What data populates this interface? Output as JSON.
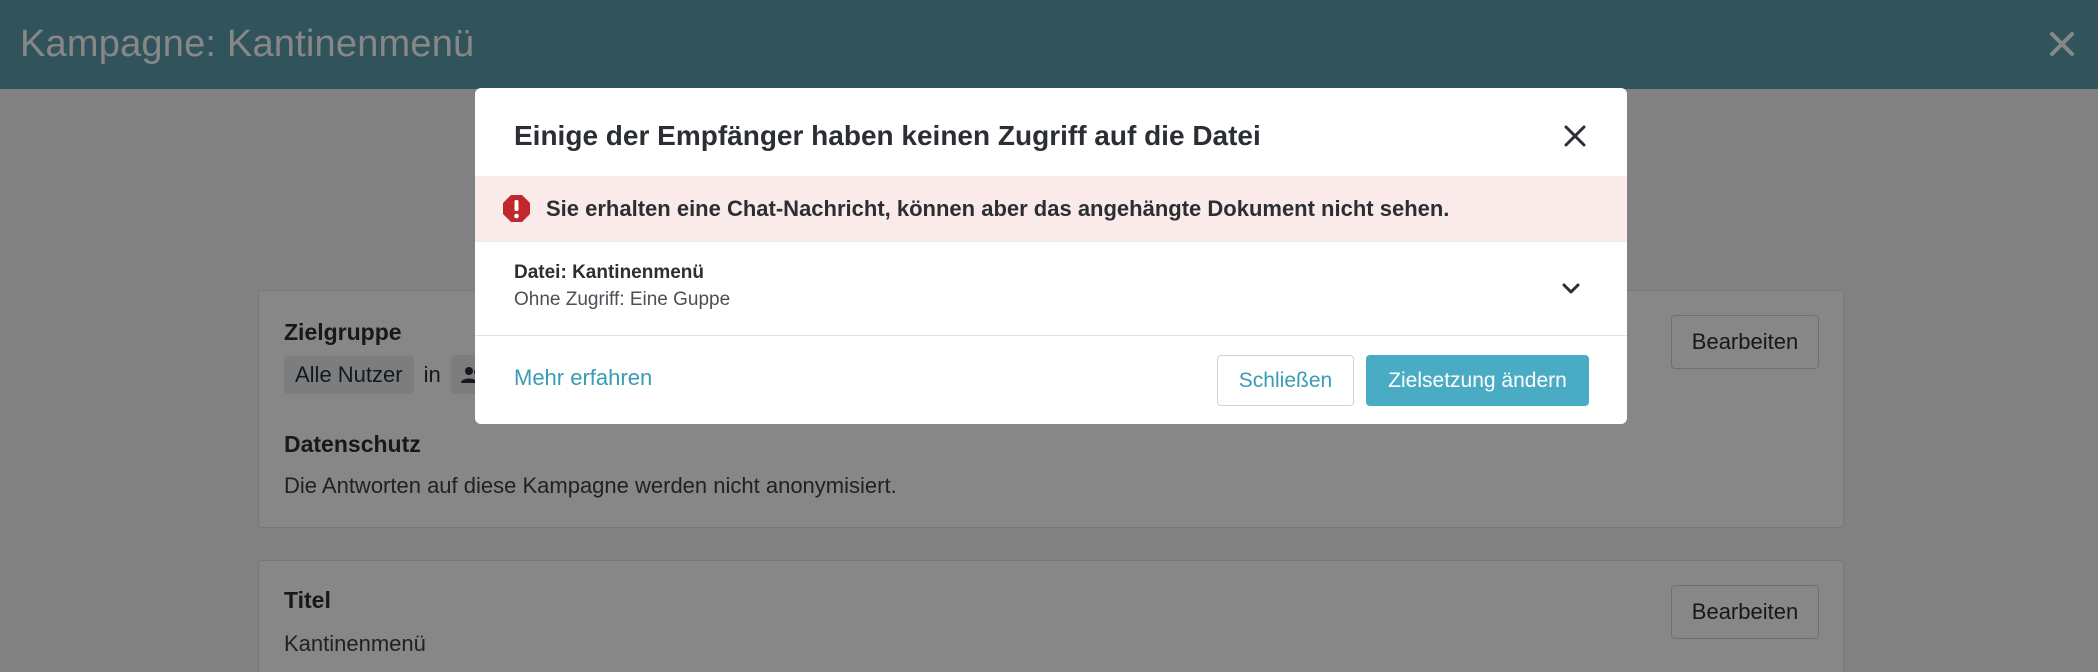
{
  "header": {
    "title": "Kampagne: Kantinenmenü",
    "close_icon": "close-icon"
  },
  "page": {
    "audience": {
      "label": "Zielgruppe",
      "chip_all": "Alle Nutzer",
      "in_text": "in",
      "group_icon": "users-icon",
      "edit_label": "Bearbeiten"
    },
    "privacy": {
      "label": "Datenschutz",
      "text": "Die Antworten auf diese Kampagne werden nicht anonymisiert."
    },
    "title_section": {
      "label": "Titel",
      "value": "Kantinenmenü",
      "edit_label": "Bearbeiten"
    }
  },
  "modal": {
    "title": "Einige der Empfänger haben keinen Zugriff auf die Datei",
    "close_icon": "close-icon",
    "alert": {
      "icon": "error-icon",
      "text": "Sie erhalten eine Chat-Nachricht, können aber das angehängte Dokument nicht sehen."
    },
    "file": {
      "name": "Datei: Kantinenmenü",
      "subtitle": "Ohne Zugriff: Eine Guppe",
      "chevron_icon": "chevron-down-icon"
    },
    "learn_more": "Mehr erfahren",
    "close_label": "Schließen",
    "primary_label": "Zielsetzung ändern"
  },
  "colors": {
    "header": "#5d9fae",
    "accent": "#4aacc4",
    "link": "#3a9bb5",
    "alert_bg": "#fbeaea",
    "error": "#c0282d"
  }
}
